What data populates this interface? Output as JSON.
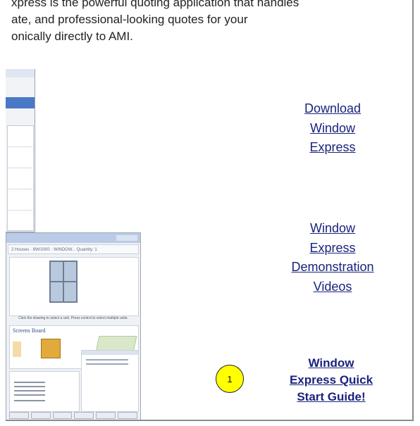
{
  "intro": {
    "lines": [
      "xpress is the powerful quoting application that handles",
      "ate, and professional-looking quotes for your",
      "onically directly to AMI."
    ]
  },
  "links": {
    "download": [
      "Download",
      "Window",
      "Express"
    ],
    "demo": [
      "Window",
      "Express",
      "Demonstration",
      "Videos"
    ],
    "quickstart": [
      "Window",
      "Express Quick",
      "Start Guide!"
    ]
  },
  "badge": {
    "number": "1",
    "color": "#ffff00"
  },
  "link_color": "#1a237e",
  "thumbnails": {
    "info_text": "2 Houses · 8W/2000 · WINDOW...   Quantity: 1",
    "section_title": "Screens Board",
    "caption": "Click the drawing to select a unit. Press control to select multiple units."
  }
}
